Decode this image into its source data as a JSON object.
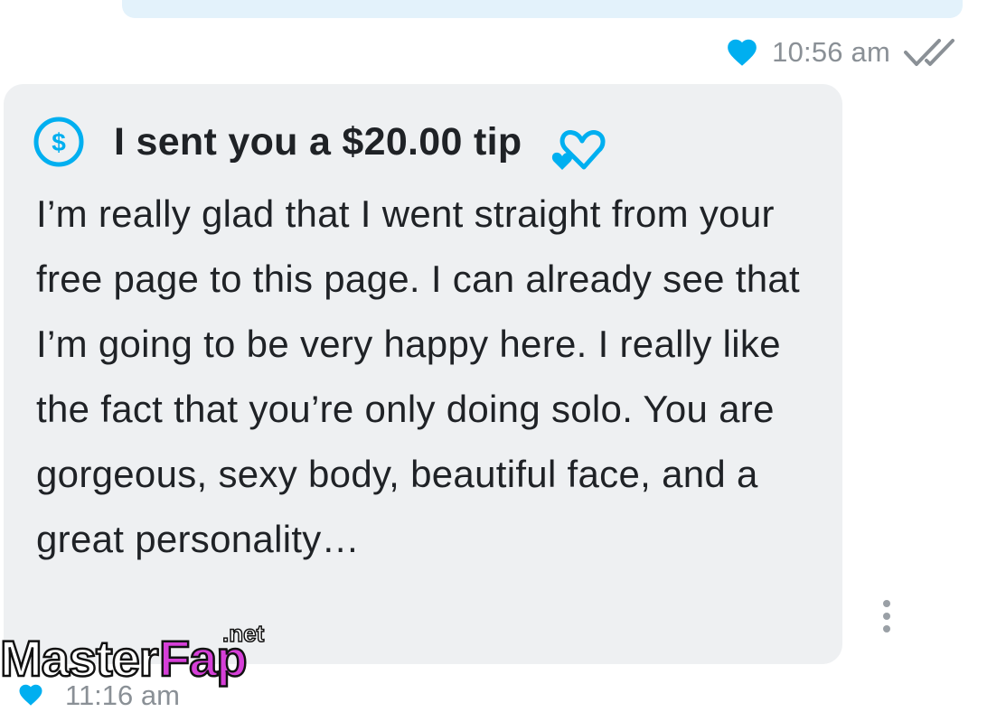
{
  "outgoing": {
    "timestamp": "10:56 am",
    "liked": true,
    "status": "read"
  },
  "incoming": {
    "tip_label": "I sent you a $20.00 tip",
    "message": "I’m really glad that I went straight from your free page to this page. I can already see that I’m going to be very happy here. I really like the fact that you’re only doing solo. You are gorgeous, sexy body, beautiful face, and a great personality…"
  },
  "next_message": {
    "timestamp": "11:16 am"
  },
  "watermark": {
    "brand": "MasterFap",
    "suffix": ".net"
  },
  "icons": {
    "like": "heart-icon",
    "read_receipt": "double-check-icon",
    "tip": "dollar-circle-icon",
    "reaction": "hearts-icon",
    "more": "more-vertical-icon"
  },
  "colors": {
    "accent": "#00aff0",
    "sent_bubble": "#e3f2fb",
    "received_bubble": "#eef0f2",
    "meta_text": "#8a9096",
    "text": "#1f2226"
  }
}
